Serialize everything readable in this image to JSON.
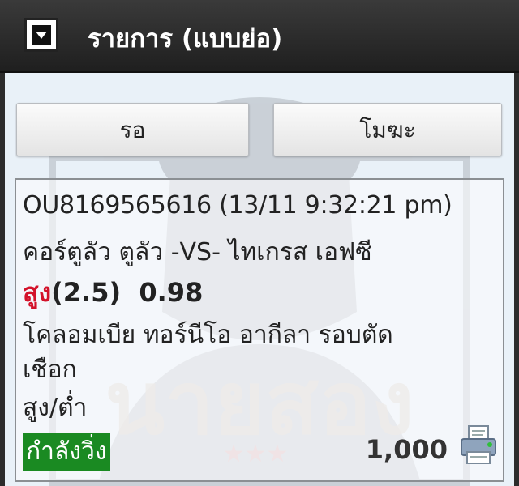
{
  "header": {
    "title": "รายการ (แบบย่อ)"
  },
  "tabs": [
    {
      "label": "รอ"
    },
    {
      "label": "โมฆะ"
    }
  ],
  "bet": {
    "ref_line": "OU8169565616 (13/11 9:32:21 pm)",
    "match": "คอร์ตูลัว ตูลัว -VS- ไทเกรส เอฟซี",
    "pick": "สูง",
    "handicap": "(2.5)",
    "odds": "0.98",
    "league_line1": "โคลอมเบีย ทอร์นีโอ อากีลา รอบตัด",
    "league_line2": "เชือก",
    "bet_type": "สูง/ต่ำ",
    "status": "กำลังวิ่ง",
    "stake": "1,000"
  },
  "watermark": {
    "text": "นายสอง",
    "stars": "★★★"
  },
  "colors": {
    "accent_red": "#d3122a",
    "status_green": "#1a8a22"
  },
  "icons": [
    "chevron-down-icon",
    "printer-icon"
  ]
}
